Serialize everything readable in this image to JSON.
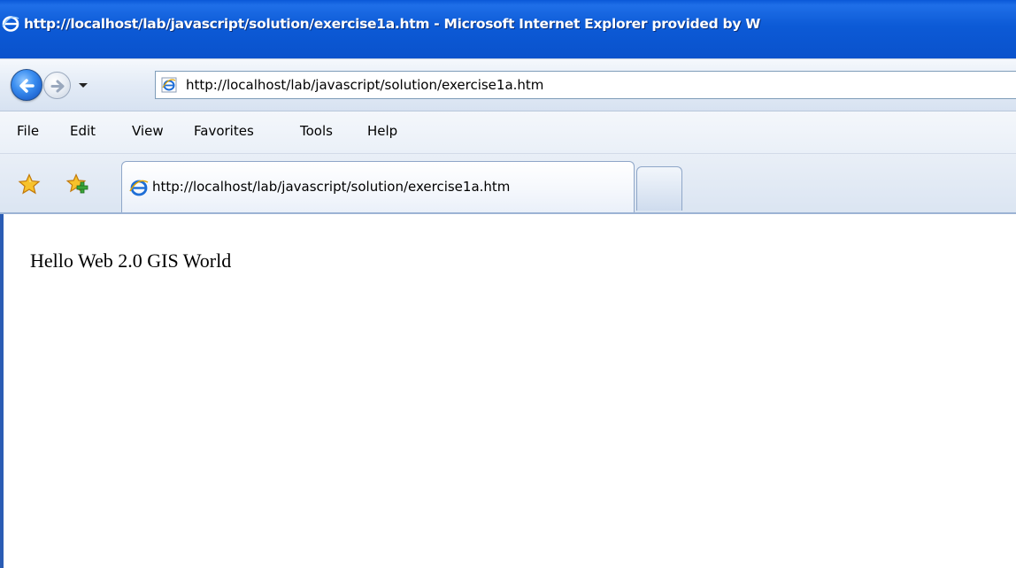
{
  "window": {
    "title": "http://localhost/lab/javascript/solution/exercise1a.htm - Microsoft Internet Explorer provided by W"
  },
  "navigation": {
    "back_icon": "back-arrow-icon",
    "forward_icon": "forward-arrow-icon",
    "dropdown_icon": "chevron-down-icon",
    "address_icon": "ie-page-icon",
    "address_value": "http://localhost/lab/javascript/solution/exercise1a.htm"
  },
  "menu": {
    "items": [
      "File",
      "Edit",
      "View",
      "Favorites",
      "Tools",
      "Help"
    ]
  },
  "tabs": {
    "favorites_icon": "star-icon",
    "add_favorite_icon": "add-favorite-icon",
    "active": {
      "label": "http://localhost/lab/javascript/solution/exercise1a.htm",
      "icon": "ie-icon"
    }
  },
  "page": {
    "text": "Hello Web 2.0 GIS World"
  },
  "colors": {
    "titlebar": "#0a52cc",
    "chrome": "#dbe5f2",
    "accent": "#2a5cb4"
  }
}
